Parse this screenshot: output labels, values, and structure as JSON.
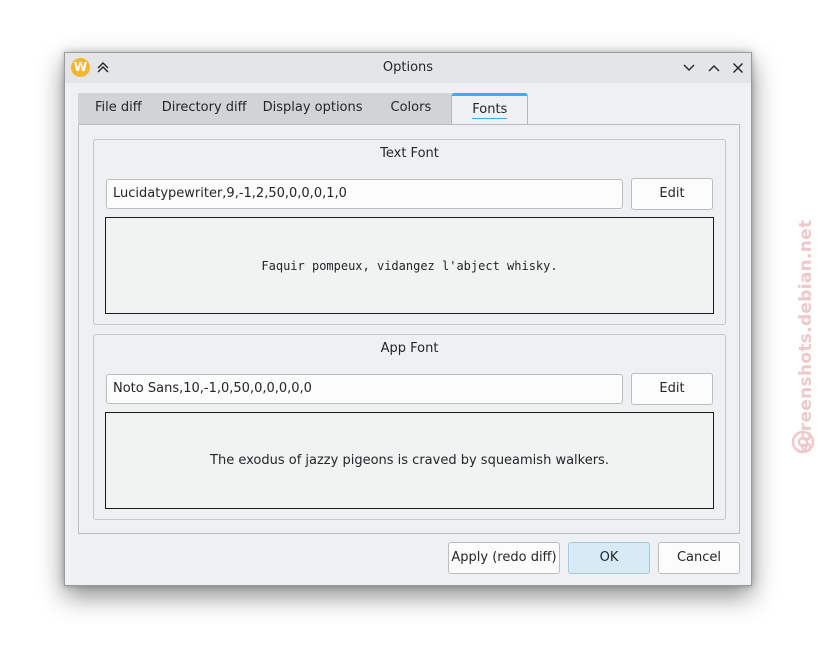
{
  "window": {
    "title": "Options",
    "app_icon_letter": "W"
  },
  "tabs": [
    {
      "label": "File diff",
      "active": false
    },
    {
      "label": "Directory diff",
      "active": false
    },
    {
      "label": "Display options",
      "active": false
    },
    {
      "label": "Colors",
      "active": false
    },
    {
      "label": "Fonts",
      "active": true
    }
  ],
  "text_font": {
    "title": "Text Font",
    "value": "Lucidatypewriter,9,-1,2,50,0,0,0,1,0",
    "edit_label": "Edit",
    "preview": "Faquir pompeux, vidangez l'abject whisky."
  },
  "app_font": {
    "title": "App Font",
    "value": "Noto Sans,10,-1,0,50,0,0,0,0,0",
    "edit_label": "Edit",
    "preview": "The exodus of jazzy pigeons is craved by squeamish walkers."
  },
  "buttons": {
    "apply": "Apply (redo diff)",
    "ok": "OK",
    "cancel": "Cancel"
  },
  "watermark": "screenshots.debian.net",
  "colors": {
    "accent": "#3daee9",
    "window_bg": "#eff0f1",
    "default_button_bg": "#d6ebf6"
  },
  "icons": [
    "app-icon",
    "keep-above-icon",
    "minimize-icon",
    "maximize-icon",
    "close-icon"
  ]
}
